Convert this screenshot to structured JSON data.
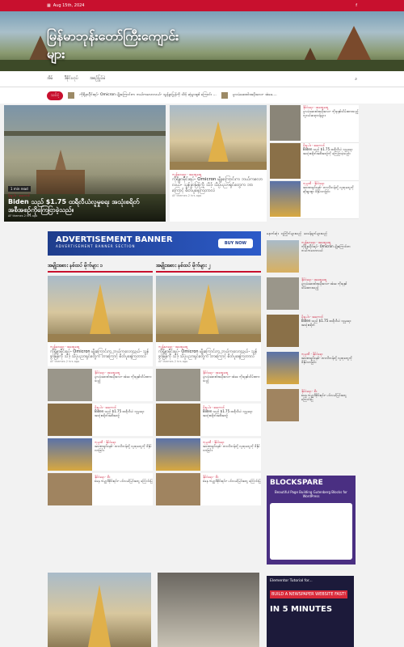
{
  "topbar": {
    "date": "Aug 15th, 2024"
  },
  "site": {
    "title": "မြန်မာဘုန်းတော်ကြီးကျောင်းများ"
  },
  "menu": {
    "items": [
      "အိမ်",
      "ဒီဇိုင်းဟုပ်",
      "အစဉ်ပြုပ်မဲ"
    ]
  },
  "ticker": {
    "label": "သင်ငံ့",
    "items": [
      "ကိုရိုနာမ်ိုင်းရပ်- Omicron မျိုးကြောင်းက ဘယ်ကလောလယ်- သွန်ခွာမြန်ကို သိဒ့် ဆုံပွားရှစ် ကြောင်း ...",
      "မူလမံဆေးဝါးအမိုးလေး- အံခေ...."
    ]
  },
  "feature_left": {
    "badge": "1 min read",
    "tag": "မိုးမှုပါး · အကောင်",
    "title": "Biden သည် $1.75 ထရီလီယံလူမှုရေး အသုံးစရိတ်အစီအစဉ်ကိုကြေငြာခဲ့သည်။",
    "author": "AF themes",
    "ago": "2 hrs ago"
  },
  "feature_mid": {
    "tag": "ကျန်းမာရေး · အထွေထွေ",
    "title": "ကိုရိုနာမ်ိုင်းရပ်- Omicron မျိုးကြောင်းက ဘယ်ကလောလယ်- သွန်ခွာမြန်ကို သိဒ့် သိပ္ပံပညာရှင်တွေက ဘာကြောင့် စိတ်ပူနေကြတာလဲ",
    "author": "AF themes",
    "ago": "2 hrs ago"
  },
  "feature_right": [
    {
      "tag": "နိုင်ငံရေး · အထွေထွေ",
      "title": "မူလမံဆေးဝါးအမိုးလေး- ကိုးခုနှစ်သိမ်းထားသည့် လူငယ်ဆရာဝန်များ"
    },
    {
      "tag": "မိုးမှုပါး · အကောင်",
      "title": "Biden သည် $1.75 ထရီလီယံ လူမှုရေးအသုံးစရိတ်အစီအစဉ်ကို ကြေငြာခဲ့သည်။"
    },
    {
      "tag": "ကုမ္ပဏီ · နိုင်ငံရေး",
      "title": "အာဏာရှင်စနစ်- တာလီဘန်တို့ လူထုတွေကို ဆိုးရွားစွာ ဖိနှိပ်လာခြင်း"
    }
  ],
  "ad": {
    "title": "ADVERTISEMENT BANNER",
    "sub": "ADVERTISEMENT BANNER SECTION",
    "button": "BUY NOW"
  },
  "col1": {
    "heading": "အမျိုးအစား နစ်ထပ် မိုက်များ ၁",
    "card": {
      "tag": "ကျန်းမာရေး · အထွေထွေ",
      "title": "ကိုရိုနာမ်ိုင်းရပ်- Omicron မျိုးကြောင်းက ဘယ်ကလောလယ်- သွန်ခွာမြန်ကို သိဒ့် သိပ္ပံပညာရှင်တွေက ဘာကြောင့် စိတ်ပူနေကြတာလဲ",
      "author": "AF themes",
      "ago": "2 hrs ago"
    },
    "rows": [
      {
        "tag": "နိုင်ငံရေး · အထွေထွေ",
        "title": "မူလမံဆေးဝါးအမိုးလေး- အံခေ ကိုးခုနှစ်သိမ်းထားသည့်"
      },
      {
        "tag": "မိုးမှုပါး · အကောင်",
        "title": "Biden သည် $1.75 ထရီလီယံ လူမှုရေးအသုံးစရိတ်အစီအစဉ်"
      },
      {
        "tag": "ကုမ္ပဏီ · နိုင်ငံရေး",
        "title": "အာဏာရှင်စနစ်- တာလီဘန်တို့ လူထုတွေကို ဖိနှိပ်လာခြင်း"
      },
      {
        "tag": "နိုင်ငံရေး · စီး",
        "title": "စနေ ကမ္ဘာ့ဒီဇိုင်းရင်း- ပင်လယ်မြင်းတွေ ကြောင်းပြ"
      }
    ]
  },
  "col2": {
    "heading": "အမျိုးအစား နစ်ထပ် မိုက်များ ၂",
    "card": {
      "tag": "ကျန်းမာရေး · အထွေထွေ",
      "title": "ကိုရိုနာမ်ိုင်းရပ်- Omicron မျိုးကြောင်းက ဘယ်ကလောလယ်- သွန်ခွာမြန်ကို သိဒ့် သိပ္ပံပညာရှင်တွေက ဘာကြောင့် စိတ်ပူနေကြတာလဲ",
      "author": "AF themes",
      "ago": "2 hrs ago"
    },
    "rows": [
      {
        "tag": "နိုင်ငံရေး · အထွေထွေ",
        "title": "မူလမံဆေးဝါးအမိုးလေး- အံခေ ကိုးခုနှစ်သိမ်းထားသည့်"
      },
      {
        "tag": "မိုးမှုပါး · အကောင်",
        "title": "Biden သည် $1.75 ထရီလီယံ လူမှုရေးအသုံးစရိတ်အစီအစဉ်"
      },
      {
        "tag": "ကုမ္ပဏီ · နိုင်ငံရေး",
        "title": "အာဏာရှင်စနစ်- တာလီဘန်တို့ လူထုတွေကို ဖိနှိပ်လာခြင်း"
      },
      {
        "tag": "နိုင်ငံရေး · စီး",
        "title": "စနေ ကမ္ဘာ့ဒီဇိုင်းရင်း- ပင်လယ်မြင်းတွေ ကြောင်းပြ"
      }
    ]
  },
  "side": {
    "tabs": [
      "နောက်ဆုံး",
      "လူကြိုက်များသည်",
      "ဝေဖန်ချက်များသည်"
    ],
    "items": [
      {
        "tag": "ကျန်းမာရေး · အထွေထွေ",
        "title": "ကိုရိုနာမ်ိုင်းရပ်- Omicron မျိုးကြောင်းက ဘယ်ကလောလယ်"
      },
      {
        "tag": "နိုင်ငံရေး · အထွေထွေ",
        "title": "မူလမံဆေးဝါးအမိုးလေး- အံခေ ကိုးခုနှစ်သိမ်းထားသည့်"
      },
      {
        "tag": "မိုးမှုပါး · အကောင်",
        "title": "Biden သည် $1.75 ထရီလီယံ လူမှုရေးအသုံးစရိတ်"
      },
      {
        "tag": "ကုမ္ပဏီ · နိုင်ငံရေး",
        "title": "အာဏာရှင်စနစ်- တာလီဘန်တို့ လူထုတွေကို ဖိနှိပ်လာခြင်း"
      },
      {
        "tag": "နိုင်ငံရေး · စီး",
        "title": "စနေ ကမ္ဘာ့ဒီဇိုင်းရင်း- ပင်လယ်မြင်းတွေ ကြောင်းပြ"
      }
    ]
  },
  "blockspare": {
    "title": "BLOCKSPARE",
    "sub": "Beautiful Page Building Gutenberg Blocks for WordPress"
  },
  "elementor": {
    "line1": "Elementor Tutorial for...",
    "line2": "BUILD A NEWSPAPER WEBSITE FAST!",
    "line3": "IN 5 MINUTES"
  }
}
